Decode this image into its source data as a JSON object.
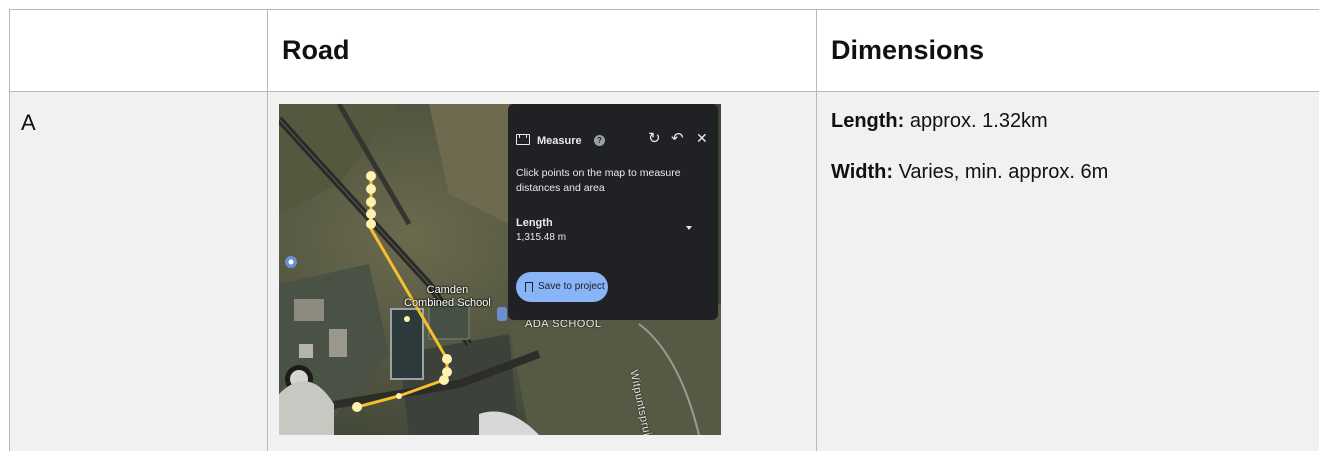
{
  "table": {
    "headers": [
      "",
      "Road",
      "Dimensions"
    ],
    "rows": [
      {
        "label": "A",
        "dimensions": {
          "length_label": "Length:",
          "length_value": " approx. 1.32km",
          "width_label": "Width:",
          "width_value": " Varies, min. approx. 6m"
        }
      }
    ]
  },
  "map": {
    "place_label_1": "Camden",
    "place_label_2": "Combined School",
    "school_label": "ADA SCHOOL",
    "road_label": "Witpuntspruit",
    "route_color": "#f5c030",
    "measure_panel": {
      "title": "Measure",
      "help_icon": "?",
      "description": "Click points on the map to measure distances and area",
      "length_label": "Length",
      "length_value": "1,315.48 m",
      "save_button": "Save to project",
      "icons": [
        "ruler-icon",
        "help-icon",
        "redo-icon",
        "undo-icon",
        "close-icon",
        "dropdown-icon",
        "bookmark-icon"
      ]
    }
  }
}
